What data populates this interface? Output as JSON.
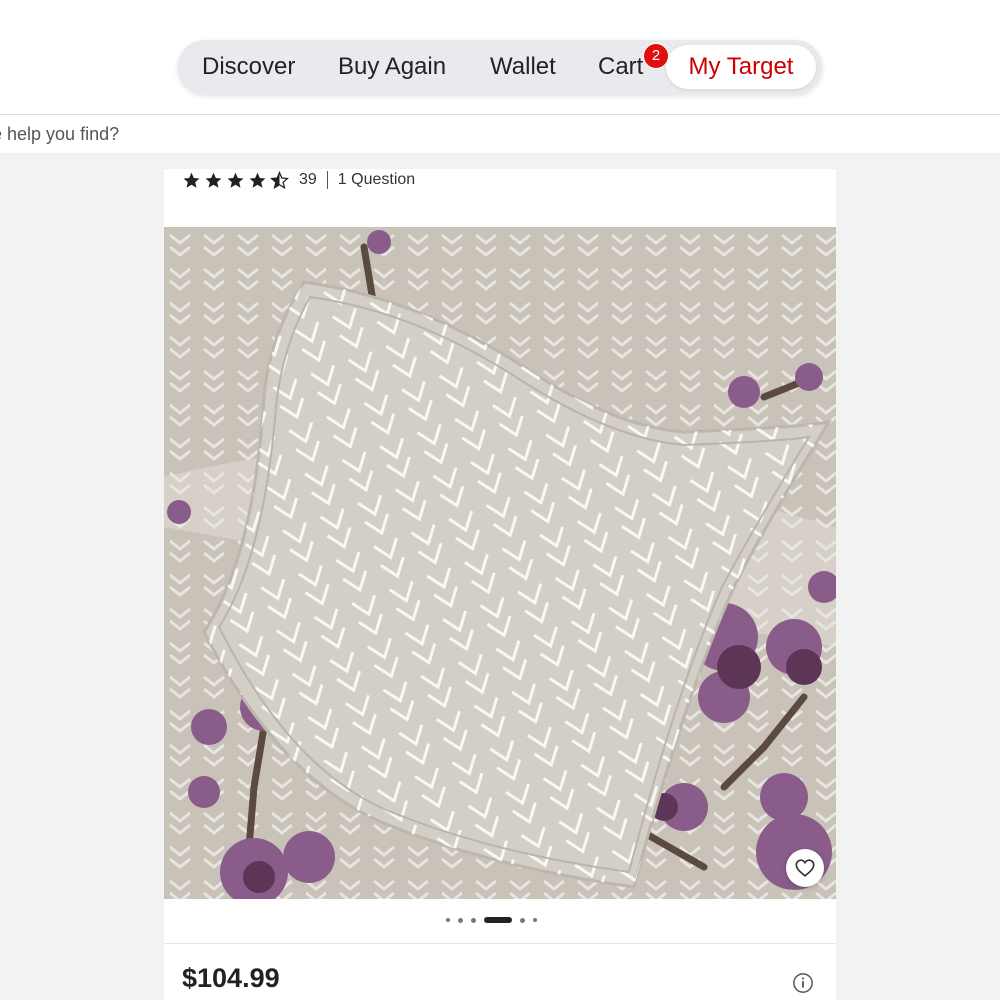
{
  "nav": {
    "items": [
      {
        "label": "Discover"
      },
      {
        "label": "Buy Again"
      },
      {
        "label": "Wallet"
      },
      {
        "label": "Cart"
      },
      {
        "label": "My Target"
      }
    ],
    "cart_badge": "2",
    "active_color": "#cc0000"
  },
  "search": {
    "placeholder": "e help you find?"
  },
  "product": {
    "rating_value": 4.5,
    "review_count": "39",
    "questions": "1 Question",
    "price": "$104.99",
    "image_icon": "pillow-product-photo",
    "carousel": {
      "total": 6,
      "active_index": 3
    }
  }
}
